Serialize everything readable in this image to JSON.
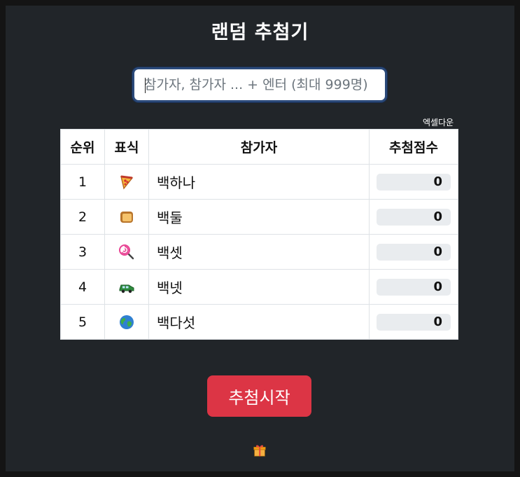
{
  "title": "랜덤 추첨기",
  "search": {
    "placeholder": "참가자, 참가자 ... + 엔터 (최대 999명)",
    "value": ""
  },
  "excel_label": "엑셀다운",
  "table": {
    "headers": [
      "순위",
      "표식",
      "참가자",
      "추첨점수"
    ],
    "rows": [
      {
        "rank": "1",
        "icon": "pizza-icon",
        "name": "백하나",
        "score": "0"
      },
      {
        "rank": "2",
        "icon": "bread-icon",
        "name": "백둘",
        "score": "0"
      },
      {
        "rank": "3",
        "icon": "lollipop-icon",
        "name": "백셋",
        "score": "0"
      },
      {
        "rank": "4",
        "icon": "car-icon",
        "name": "백넷",
        "score": "0"
      },
      {
        "rank": "5",
        "icon": "globe-icon",
        "name": "백다섯",
        "score": "0"
      }
    ]
  },
  "start_label": "추첨시작",
  "footer_icon": "gift-icon",
  "colors": {
    "background": "#212529",
    "start_button": "#dc3545",
    "score_box": "#e9ecef"
  }
}
